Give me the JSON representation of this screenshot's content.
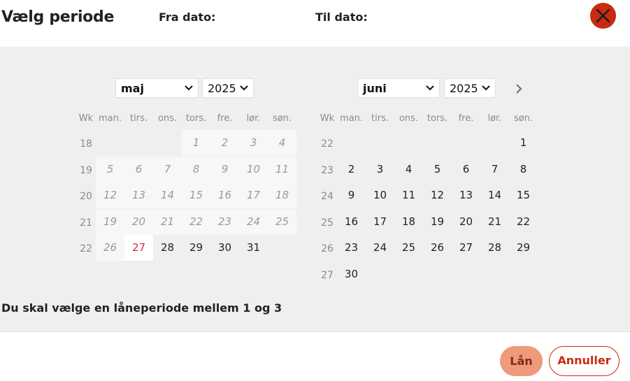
{
  "dialog": {
    "title": "Vælg periode",
    "from_label": "Fra dato:",
    "to_label": "Til dato:",
    "close_icon": "close-icon"
  },
  "colors": {
    "close_bg": "#c82b10",
    "today_text": "#d42a3a",
    "loan_bg": "#ef9a7b",
    "cancel_border": "#c82b10",
    "panel_bg": "#f0efee"
  },
  "weekday_headers": [
    "Wk",
    "man.",
    "tirs.",
    "ons.",
    "tors.",
    "fre.",
    "lør.",
    "søn."
  ],
  "calendars": [
    {
      "month": "maj",
      "year": "2025",
      "weeks": [
        {
          "wk": "18",
          "days": [
            null,
            null,
            null,
            {
              "d": "1",
              "s": "disabled"
            },
            {
              "d": "2",
              "s": "disabled"
            },
            {
              "d": "3",
              "s": "disabled"
            },
            {
              "d": "4",
              "s": "disabled"
            }
          ]
        },
        {
          "wk": "19",
          "days": [
            {
              "d": "5",
              "s": "disabled"
            },
            {
              "d": "6",
              "s": "disabled"
            },
            {
              "d": "7",
              "s": "disabled"
            },
            {
              "d": "8",
              "s": "disabled"
            },
            {
              "d": "9",
              "s": "disabled"
            },
            {
              "d": "10",
              "s": "disabled"
            },
            {
              "d": "11",
              "s": "disabled"
            }
          ]
        },
        {
          "wk": "20",
          "days": [
            {
              "d": "12",
              "s": "disabled"
            },
            {
              "d": "13",
              "s": "disabled"
            },
            {
              "d": "14",
              "s": "disabled"
            },
            {
              "d": "15",
              "s": "disabled"
            },
            {
              "d": "16",
              "s": "disabled"
            },
            {
              "d": "17",
              "s": "disabled"
            },
            {
              "d": "18",
              "s": "disabled"
            }
          ]
        },
        {
          "wk": "21",
          "days": [
            {
              "d": "19",
              "s": "disabled"
            },
            {
              "d": "20",
              "s": "disabled"
            },
            {
              "d": "21",
              "s": "disabled"
            },
            {
              "d": "22",
              "s": "disabled"
            },
            {
              "d": "23",
              "s": "disabled"
            },
            {
              "d": "24",
              "s": "disabled"
            },
            {
              "d": "25",
              "s": "disabled"
            }
          ]
        },
        {
          "wk": "22",
          "days": [
            {
              "d": "26",
              "s": "disabled"
            },
            {
              "d": "27",
              "s": "today"
            },
            {
              "d": "28",
              "s": "enabled"
            },
            {
              "d": "29",
              "s": "enabled"
            },
            {
              "d": "30",
              "s": "enabled"
            },
            {
              "d": "31",
              "s": "enabled"
            },
            null
          ]
        }
      ]
    },
    {
      "month": "juni",
      "year": "2025",
      "weeks": [
        {
          "wk": "22",
          "days": [
            null,
            null,
            null,
            null,
            null,
            null,
            {
              "d": "1",
              "s": "enabled"
            }
          ]
        },
        {
          "wk": "23",
          "days": [
            {
              "d": "2",
              "s": "enabled"
            },
            {
              "d": "3",
              "s": "enabled"
            },
            {
              "d": "4",
              "s": "enabled"
            },
            {
              "d": "5",
              "s": "enabled"
            },
            {
              "d": "6",
              "s": "enabled"
            },
            {
              "d": "7",
              "s": "enabled"
            },
            {
              "d": "8",
              "s": "enabled"
            }
          ]
        },
        {
          "wk": "24",
          "days": [
            {
              "d": "9",
              "s": "enabled"
            },
            {
              "d": "10",
              "s": "enabled"
            },
            {
              "d": "11",
              "s": "enabled"
            },
            {
              "d": "12",
              "s": "enabled"
            },
            {
              "d": "13",
              "s": "enabled"
            },
            {
              "d": "14",
              "s": "enabled"
            },
            {
              "d": "15",
              "s": "enabled"
            }
          ]
        },
        {
          "wk": "25",
          "days": [
            {
              "d": "16",
              "s": "enabled"
            },
            {
              "d": "17",
              "s": "enabled"
            },
            {
              "d": "18",
              "s": "enabled"
            },
            {
              "d": "19",
              "s": "enabled"
            },
            {
              "d": "20",
              "s": "enabled"
            },
            {
              "d": "21",
              "s": "enabled"
            },
            {
              "d": "22",
              "s": "enabled"
            }
          ]
        },
        {
          "wk": "26",
          "days": [
            {
              "d": "23",
              "s": "enabled"
            },
            {
              "d": "24",
              "s": "enabled"
            },
            {
              "d": "25",
              "s": "enabled"
            },
            {
              "d": "26",
              "s": "enabled"
            },
            {
              "d": "27",
              "s": "enabled"
            },
            {
              "d": "28",
              "s": "enabled"
            },
            {
              "d": "29",
              "s": "enabled"
            }
          ]
        },
        {
          "wk": "27",
          "days": [
            {
              "d": "30",
              "s": "enabled"
            },
            null,
            null,
            null,
            null,
            null,
            null
          ]
        }
      ]
    }
  ],
  "navigation": {
    "next_icon": "chevron-right-icon"
  },
  "info_text": "Du skal vælge en låneperiode mellem 1 og 3",
  "buttons": {
    "loan_label": "Lån",
    "cancel_label": "Annuller"
  }
}
